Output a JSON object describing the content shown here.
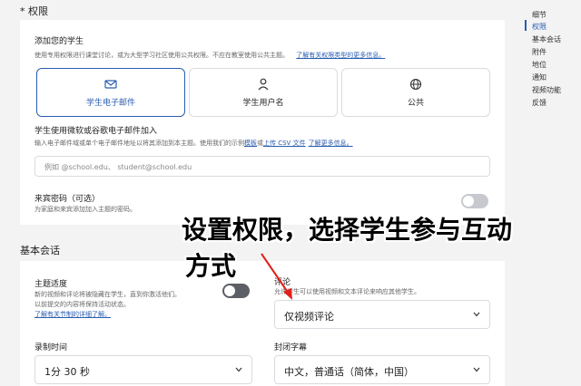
{
  "permissions": {
    "heading": "* 权限",
    "add_students_title": "添加您的学生",
    "add_students_desc": "使用专用权限进行课堂讨论，或为大型学习社区使用公共权限。不应在教室使用公共主题。",
    "learn_more_link": "了解有关权限类型的更多信息。",
    "options": [
      {
        "label": "学生电子邮件",
        "icon": "mail-icon",
        "selected": true
      },
      {
        "label": "学生用户名",
        "icon": "person-icon",
        "selected": false
      },
      {
        "label": "公共",
        "icon": "globe-icon",
        "selected": false
      }
    ],
    "ms_google_title": "学生使用微软或谷歌电子邮件加入",
    "ms_google_desc": "输入电子邮件域或单个电子邮件地址以将其添加到本主题。使用我们的示例",
    "template_link": "模板",
    "upload_pre": "或",
    "upload_link": "上传 CSV 文件",
    "more_link": "了解更多信息。",
    "email_placeholder": "例如 @school.edu、 student@school.edu",
    "guest_password_title": "来宾密码（可选）",
    "guest_password_desc": "为家庭和来宾添加加入主题的密码。"
  },
  "basic_session": {
    "heading": "基本会话",
    "topic_moderation_title": "主题适度",
    "topic_moderation_desc1": "新的视频和评论将被隐藏在学生，直到你激活他们。",
    "topic_moderation_desc2": "以前提交的内容将保持活动状态。",
    "topic_moderation_link": "了解有关节制的详细了解。",
    "comments_title": "评论",
    "comments_desc": "允许学生可以使用视频和文本评论来响应其他学生。",
    "comments_value": "仅视频评论",
    "record_time_title": "录制时间",
    "record_time_value": "1分 30 秒",
    "captions_title": "封闭字幕",
    "captions_value": "中文，普通话（简体，中国）"
  },
  "right_nav": {
    "items": [
      "细节",
      "权限",
      "基本会话",
      "附件",
      "地位",
      "通知",
      "视频功能",
      "反馈"
    ],
    "active_index": 1
  },
  "annotation": {
    "line1": "设置权限，选择学生参与互动",
    "line2": "方式"
  },
  "colors": {
    "accent": "#2a5db0",
    "annotation_arrow": "#e0201b"
  }
}
